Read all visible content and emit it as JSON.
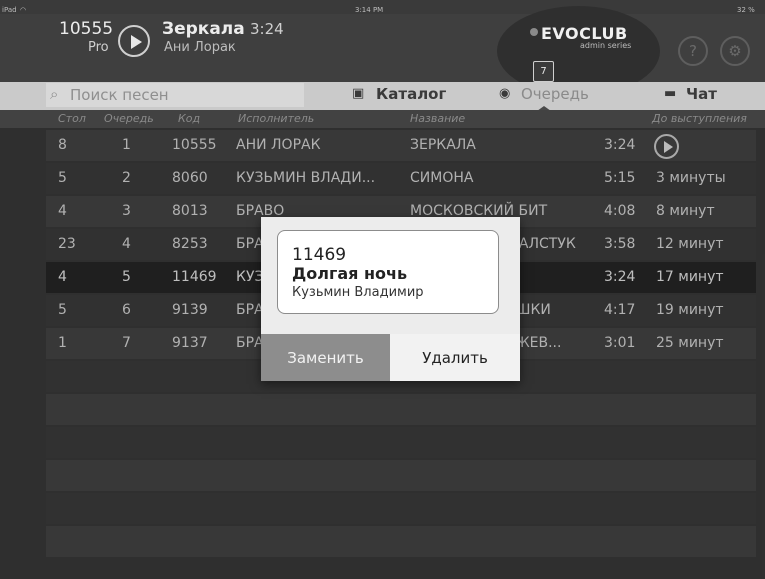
{
  "statusbar": {
    "device": "iPad",
    "wifi_icon": "wifi-icon",
    "time": "3:14 PM",
    "battery": "32 %"
  },
  "now_playing": {
    "code": "10555",
    "plan": "Pro",
    "title": "Зеркала",
    "time": "3:24",
    "artist": "Ани Лорак"
  },
  "brand": {
    "name": "EVOCLUB",
    "subtitle": "admin series"
  },
  "header_icons": {
    "help": "?",
    "help_icon": "question-circle-icon",
    "settings_icon": "settings-circle-icon"
  },
  "toolbar": {
    "search_placeholder": "Поиск песен",
    "tabs": [
      {
        "label": "Каталог",
        "icon": "book-icon"
      },
      {
        "label": "Очередь",
        "icon": "users-icon",
        "badge": "7"
      },
      {
        "label": "Чат",
        "icon": "chat-icon"
      }
    ]
  },
  "table": {
    "columns": [
      "Стол",
      "Очередь",
      "Код",
      "Исполнитель",
      "Название",
      "До выступления"
    ],
    "rows": [
      {
        "table": "8",
        "queue": "1",
        "code": "10555",
        "artist": "АНИ ЛОРАК",
        "title": "ЗЕРКАЛА",
        "duration": "3:24",
        "until": "",
        "until_icon": "play-circle-icon"
      },
      {
        "table": "5",
        "queue": "2",
        "code": "8060",
        "artist": "КУЗЬМИН ВЛАДИ...",
        "title": "СИМОНА",
        "duration": "5:15",
        "until": "3 минуты"
      },
      {
        "table": "4",
        "queue": "3",
        "code": "8013",
        "artist": "БРАВО",
        "title": "МОСКОВСКИЙ БИТ",
        "duration": "4:08",
        "until": "8 минут"
      },
      {
        "table": "23",
        "queue": "4",
        "code": "8253",
        "artist": "БРАВО",
        "title": "ОРАНЖЕВЫЙ ГАЛСТУК",
        "duration": "3:58",
        "until": "12 минут"
      },
      {
        "table": "4",
        "queue": "5",
        "code": "11469",
        "artist": "КУЗЬМИН ВЛАДИМИР",
        "title": "ДОЛГАЯ НОЧЬ",
        "duration": "3:24",
        "until": "17 минут"
      },
      {
        "table": "5",
        "queue": "6",
        "code": "9139",
        "artist": "БРАВО",
        "title": "ЛЮБИТЕ ДЕВУШКИ",
        "duration": "4:17",
        "until": "19 минут"
      },
      {
        "table": "1",
        "queue": "7",
        "code": "9137",
        "artist": "БРАВО",
        "title": "КОРОЛЬ ОРАНЖЕВ...",
        "duration": "3:01",
        "until": "25 минут"
      }
    ]
  },
  "dialog": {
    "code": "11469",
    "title": "Долгая ночь",
    "artist": "Кузьмин Владимир",
    "replace_label": "Заменить",
    "delete_label": "Удалить"
  },
  "colors": {
    "background": "#3a3a3a",
    "toolbar": "#cacaca",
    "selected_row": "#272727",
    "dialog_primary": "#8d8d8d"
  }
}
